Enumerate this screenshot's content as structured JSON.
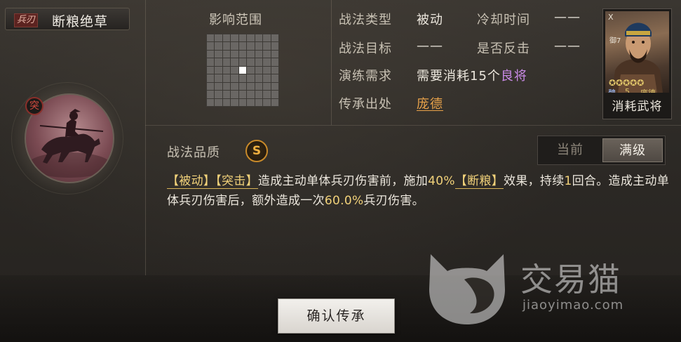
{
  "skill": {
    "type_tag": "兵刃",
    "name": "断粮绝草",
    "portrait_badge": "突"
  },
  "range": {
    "label": "影响范围",
    "grid_size": 9,
    "highlight": [
      [
        4,
        4
      ]
    ]
  },
  "stats": {
    "type_key": "战法类型",
    "type_val": "被动",
    "cooldown_key": "冷却时间",
    "cooldown_val": "——",
    "target_key": "战法目标",
    "target_val": "——",
    "counter_key": "是否反击",
    "counter_val": "——",
    "req_key": "演练需求",
    "req_prefix": "需要消耗",
    "req_num": "15个",
    "req_quality": "良将",
    "source_key": "传承出处",
    "source_val": "庞德"
  },
  "card": {
    "top_mark": "X",
    "cost_label": "御7",
    "stars": "✪✪✪✪✪",
    "faction": "魏",
    "level": "5",
    "general_name": "庞德",
    "footer": "消耗武将"
  },
  "quality": {
    "label": "战法品质",
    "grade": "S"
  },
  "toggle": {
    "current": "当前",
    "max": "满级"
  },
  "description": {
    "tag1": "【被动】",
    "tag2": "【突击】",
    "part1": "造成主动单体兵刃伤害前，施加",
    "pct1": "40%",
    "tag3": "【断粮】",
    "part2": "效果，持续",
    "dur": "1",
    "part3": "回合。造成主动单体兵刃伤害后，额外造成一次",
    "pct2": "60.0%",
    "part4": "兵刃伤害。"
  },
  "watermark": {
    "brand": "交易猫",
    "url": "jiaoyimao.com"
  },
  "confirm_label": "确认传承"
}
